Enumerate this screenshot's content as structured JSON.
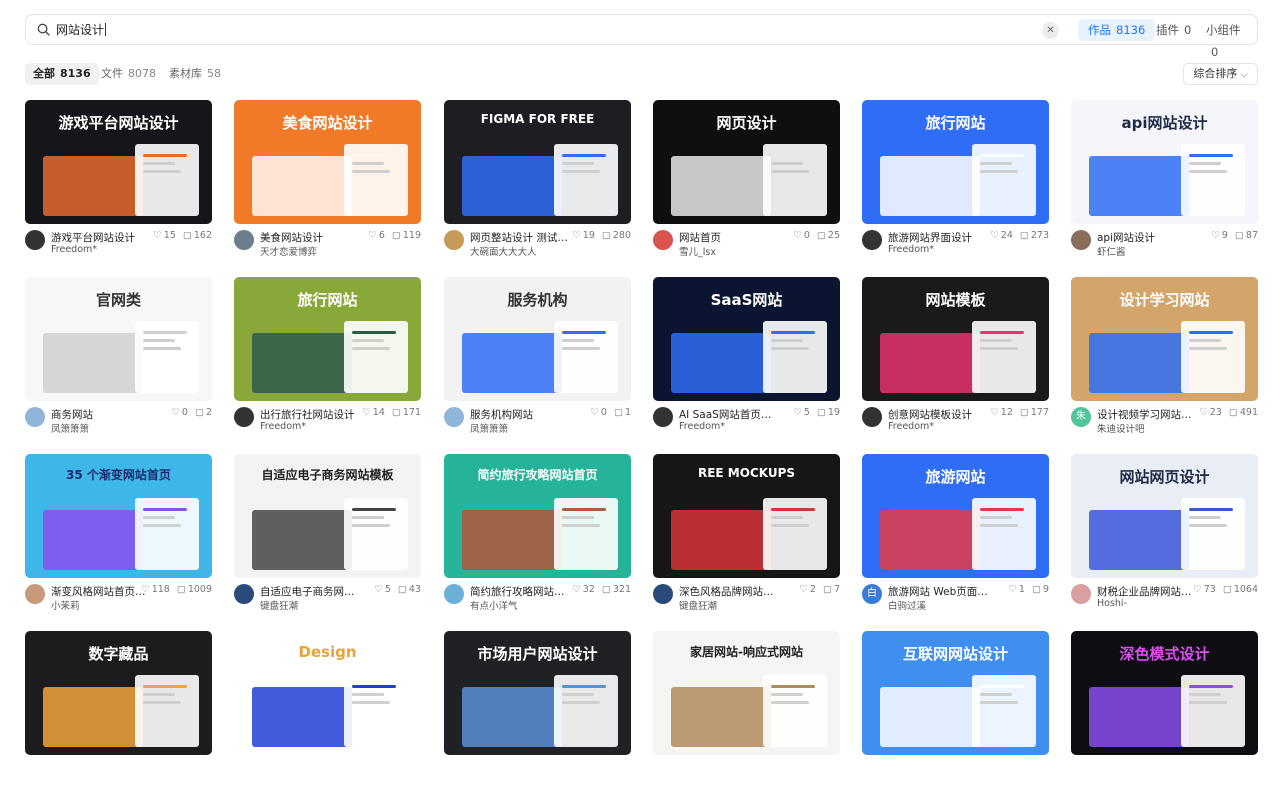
{
  "search": {
    "query": "网站设计"
  },
  "scopes": [
    {
      "label": "作品",
      "count": "8136",
      "active": true
    },
    {
      "label": "插件",
      "count": "0",
      "active": false
    },
    {
      "label": "小组件",
      "count": "0",
      "active": false
    }
  ],
  "filters": [
    {
      "label": "全部",
      "count": "8136",
      "active": true
    },
    {
      "label": "文件",
      "count": "8078",
      "active": false
    },
    {
      "label": "素材库",
      "count": "58",
      "active": false
    }
  ],
  "sort_label": "综合排序",
  "cards": [
    {
      "title": "游戏平台网站设计",
      "author": "Freedom*",
      "likes": "15",
      "comments": "162",
      "thumb_text": "游戏平台网站设计",
      "thumb_bg": "#15161b",
      "thumb_fg": "#ffffff",
      "accent": "#e56a2d",
      "avatar_color": "#333333"
    },
    {
      "title": "美食网站设计",
      "author": "天才恋爱博弈",
      "likes": "6",
      "comments": "119",
      "thumb_text": "美食网站设计",
      "thumb_bg": "#f07a28",
      "thumb_fg": "#ffffff",
      "accent": "#fff6ee",
      "avatar_color": "#6b7f8c"
    },
    {
      "title": "网页整站设计 测试类...",
      "author": "大碗面大大大人",
      "likes": "19",
      "comments": "280",
      "thumb_text": "FIGMA FOR FREE",
      "thumb_bg": "#1d1e24",
      "thumb_fg": "#ffffff",
      "accent": "#2f6df6",
      "avatar_color": "#c89a5a"
    },
    {
      "title": "网站首页",
      "author": "雪儿_lsx",
      "likes": "0",
      "comments": "25",
      "thumb_text": "网页设计",
      "thumb_bg": "#0f0f10",
      "thumb_fg": "#ffffff",
      "accent": "#e8e8e8",
      "avatar_color": "#d9534f"
    },
    {
      "title": "旅游网站界面设计",
      "author": "Freedom*",
      "likes": "24",
      "comments": "273",
      "thumb_text": "旅行网站",
      "thumb_bg": "#2f6df6",
      "thumb_fg": "#ffffff",
      "accent": "#ffffff",
      "avatar_color": "#333333"
    },
    {
      "title": "api网站设计",
      "author": "虾仁酱",
      "likes": "9",
      "comments": "87",
      "thumb_text": "api网站设计",
      "thumb_bg": "#f4f6fb",
      "thumb_fg": "#1f2a44",
      "accent": "#2f6df6",
      "avatar_color": "#8a6d5a"
    },
    {
      "title": "商务网站",
      "author": "凤箫箫箫",
      "likes": "0",
      "comments": "2",
      "thumb_text": "官网类",
      "thumb_bg": "#f7f7f7",
      "thumb_fg": "#333333",
      "accent": "#d0d0d0",
      "avatar_color": "#8fb6d8"
    },
    {
      "title": "出行旅行社网站设计",
      "author": "Freedom*",
      "likes": "14",
      "comments": "171",
      "thumb_text": "旅行网站",
      "thumb_bg": "#8aa83a",
      "thumb_fg": "#ffffff",
      "accent": "#2d5a4a",
      "avatar_color": "#333333"
    },
    {
      "title": "服务机构网站",
      "author": "凤箫箫箫",
      "likes": "0",
      "comments": "1",
      "thumb_text": "服务机构",
      "thumb_bg": "#f2f2f2",
      "thumb_fg": "#333333",
      "accent": "#2f6df6",
      "avatar_color": "#8fb6d8"
    },
    {
      "title": "AI SaaS网站首页设计",
      "author": "Freedom*",
      "likes": "5",
      "comments": "19",
      "thumb_text": "SaaS网站",
      "thumb_bg": "#0b1430",
      "thumb_fg": "#ffffff",
      "accent": "#2f6df6",
      "avatar_color": "#333333"
    },
    {
      "title": "创意网站模板设计",
      "author": "Freedom*",
      "likes": "12",
      "comments": "177",
      "thumb_text": "网站模板",
      "thumb_bg": "#1a1a1a",
      "thumb_fg": "#ffffff",
      "accent": "#e8336e",
      "avatar_color": "#333333"
    },
    {
      "title": "设计视频学习网站管...",
      "author": "朱迪设计吧",
      "likes": "23",
      "comments": "491",
      "thumb_text": "设计学习网站",
      "thumb_bg": "#d4a56a",
      "thumb_fg": "#ffffff",
      "accent": "#2f6df6",
      "avatar_color": "#52c49a",
      "avatar_text": "朱"
    },
    {
      "title": "渐变风格网站首页和...",
      "author": "小茉莉",
      "likes": "118",
      "comments": "1009",
      "thumb_text": "35 个渐变网站首页",
      "thumb_bg": "#3fb6e8",
      "thumb_fg": "#1a2a6c",
      "accent": "#8a4df0",
      "avatar_color": "#c99a7a"
    },
    {
      "title": "自适应电子商务网站模板",
      "author": "键盘狂潮",
      "likes": "5",
      "comments": "43",
      "thumb_text": "自适应电子商务网站模板",
      "thumb_bg": "#f3f3f3",
      "thumb_fg": "#222222",
      "accent": "#444444",
      "avatar_color": "#2a4a7a"
    },
    {
      "title": "简约旅行攻略网站首页",
      "author": "有点小洋气",
      "likes": "32",
      "comments": "321",
      "thumb_text": "简约旅行攻略网站首页",
      "thumb_bg": "#25b39a",
      "thumb_fg": "#ffffff",
      "accent": "#b5553a",
      "avatar_color": "#6ab0d8"
    },
    {
      "title": "深色风格品牌网站模板",
      "author": "键盘狂潮",
      "likes": "2",
      "comments": "7",
      "thumb_text": "REE MOCKUPS",
      "thumb_bg": "#161616",
      "thumb_fg": "#ffffff",
      "accent": "#d8343a",
      "avatar_color": "#2a4a7a"
    },
    {
      "title": "旅游网站 Web页面设计",
      "author": "白驹过溪",
      "likes": "1",
      "comments": "9",
      "thumb_text": "旅游网站",
      "thumb_bg": "#2f6df6",
      "thumb_fg": "#ffffff",
      "accent": "#e63946",
      "avatar_color": "#3a7bd5",
      "avatar_text": "白"
    },
    {
      "title": "财税企业品牌网站网...",
      "author": "Hoshi-",
      "likes": "73",
      "comments": "1064",
      "thumb_text": "网站网页设计",
      "thumb_bg": "#e8edf6",
      "thumb_fg": "#1f2a44",
      "accent": "#3a55d8",
      "avatar_color": "#d8a0a0"
    },
    {
      "title": "",
      "author": "",
      "likes": "",
      "comments": "",
      "thumb_text": "数字藏品",
      "thumb_bg": "#1c1c1e",
      "thumb_fg": "#ffffff",
      "accent": "#f2a33a",
      "avatar_color": "#ffffff"
    },
    {
      "title": "",
      "author": "",
      "likes": "",
      "comments": "",
      "thumb_text": "Design",
      "thumb_bg": "#ffffff",
      "thumb_fg": "#e8a33a",
      "accent": "#1f3fd6",
      "avatar_color": "#ffffff"
    },
    {
      "title": "",
      "author": "",
      "likes": "",
      "comments": "",
      "thumb_text": "市场用户网站设计",
      "thumb_bg": "#202124",
      "thumb_fg": "#ffffff",
      "accent": "#5a8fd8",
      "avatar_color": "#ffffff"
    },
    {
      "title": "",
      "author": "",
      "likes": "",
      "comments": "",
      "thumb_text": "家居网站-响应式网站",
      "thumb_bg": "#f5f5f3",
      "thumb_fg": "#222222",
      "accent": "#b08a5a",
      "avatar_color": "#ffffff"
    },
    {
      "title": "",
      "author": "",
      "likes": "",
      "comments": "",
      "thumb_text": "互联网网站设计",
      "thumb_bg": "#3f8ef0",
      "thumb_fg": "#ffffff",
      "accent": "#ffffff",
      "avatar_color": "#ffffff"
    },
    {
      "title": "",
      "author": "",
      "likes": "",
      "comments": "",
      "thumb_text": "深色模式设计",
      "thumb_bg": "#0e0e12",
      "thumb_fg": "#d94ef0",
      "accent": "#8a4df0",
      "avatar_color": "#ffffff"
    }
  ],
  "icons": {
    "search": "search-icon",
    "clear": "close-icon",
    "sort_chevron": "chevron-down-icon",
    "like": "heart-icon",
    "comment": "comment-icon"
  }
}
